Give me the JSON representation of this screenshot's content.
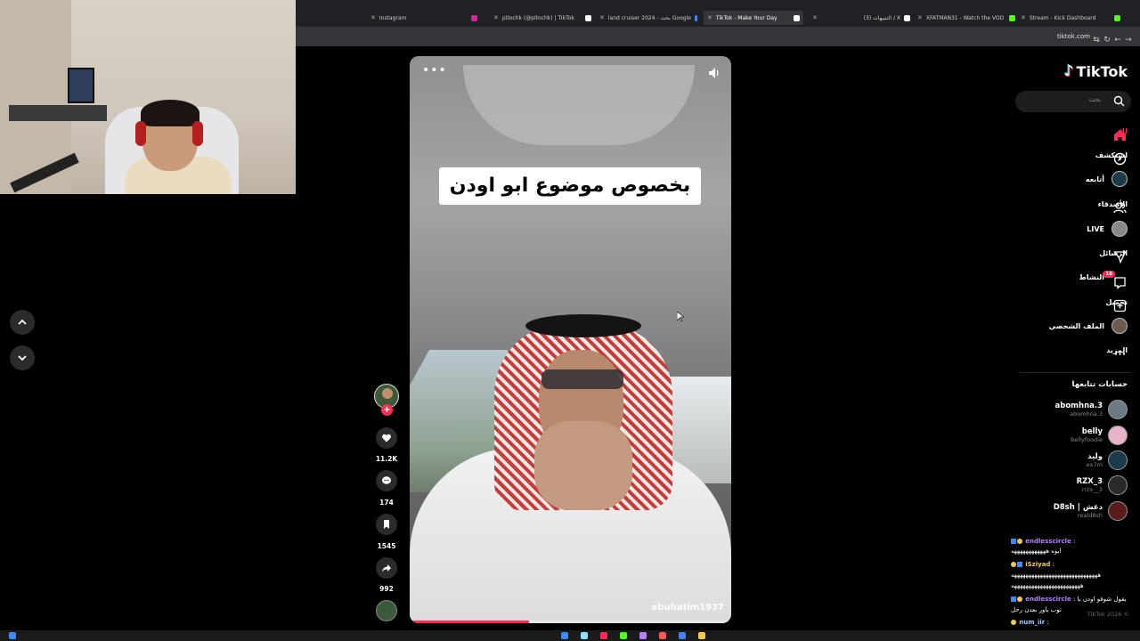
{
  "browser": {
    "tabs": [
      {
        "title": "Instagram",
        "color": "#d6249f"
      },
      {
        "title": "pitochk (@pitochk) | TikTok",
        "color": "#ffffff"
      },
      {
        "title": "land cruiser 2024 - بحث Google",
        "color": "#4285f4"
      },
      {
        "title": "TikTok - Make Your Day",
        "color": "#ffffff",
        "active": true
      },
      {
        "title": "(3) التنبيهات / X",
        "color": "#ffffff"
      },
      {
        "title": "XFATMAN31 - Watch the VOD",
        "color": "#53fc18"
      },
      {
        "title": "Stream - Kick Dashboard",
        "color": "#53fc18"
      }
    ],
    "url": "tiktok.com"
  },
  "video": {
    "caption": "بخصوص موضوع ابو اودن",
    "author": "abuhatim1937",
    "progress": 0.37
  },
  "actions": {
    "likes": "11.2K",
    "comments": "174",
    "saves": "1545",
    "shares": "992"
  },
  "sidebar": {
    "logo": "TikTok",
    "search_placeholder": "بحث",
    "nav": [
      {
        "label": "لك",
        "icon": "home-icon",
        "active": true
      },
      {
        "label": "استكشف",
        "icon": "compass-icon"
      },
      {
        "label": "أتابعه",
        "icon": "following-avatar-icon"
      },
      {
        "label": "الأصدقاء",
        "icon": "friends-icon"
      },
      {
        "label": "LIVE",
        "icon": "live-icon"
      },
      {
        "label": "الرسائل",
        "icon": "messages-icon"
      },
      {
        "label": "النشاط",
        "icon": "activity-icon",
        "badge": "18"
      },
      {
        "label": "تحميل",
        "icon": "upload-icon"
      },
      {
        "label": "الملف الشخصي",
        "icon": "profile-icon"
      },
      {
        "label": "المزيد",
        "icon": "more-icon"
      }
    ],
    "following_header": "حسابات تتابعها",
    "following": [
      {
        "name": "abomhna.3",
        "handle": "abomhna.3"
      },
      {
        "name": "belly",
        "handle": "bellyfoodie"
      },
      {
        "name": "وليد",
        "handle": "ex7m"
      },
      {
        "name": "RZX_3",
        "handle": "rrzx__3"
      },
      {
        "name": "D8sh | دغش",
        "handle": "reald8sh"
      }
    ],
    "footer": "TikTok 2026 ©"
  },
  "chat": [
    {
      "user": "endlesscircle",
      "msg": "ايوه ههههههههههههه"
    },
    {
      "user": "iSziyad",
      "msg": "ههههههههههههههههههههههههههههههه"
    },
    {
      "user": "",
      "msg": "ههههههههههههههههههههههههه"
    },
    {
      "user": "endlesscircle",
      "msg": "يقول شوفو اودن با"
    },
    {
      "user": "",
      "msg": "توب ياور بعدن رحل"
    },
    {
      "user": "num_iir",
      "msg": ""
    }
  ],
  "colors": {
    "accent": "#fe2c55",
    "bg": "#000000"
  }
}
